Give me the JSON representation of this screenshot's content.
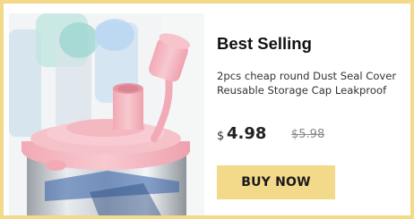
{
  "product": {
    "title": "Best Selling",
    "description_lines": [
      "2pcs cheap round Dust Seal Cover",
      "Reusable Storage Cap Leakproof"
    ],
    "currency": "$",
    "price": "4.98",
    "original_price": "$5.98",
    "buy_label": "BUY NOW"
  },
  "colors": {
    "frame": "#f3d98a",
    "button": "#f3d98a",
    "cap_pink": "#f4b8c1"
  }
}
